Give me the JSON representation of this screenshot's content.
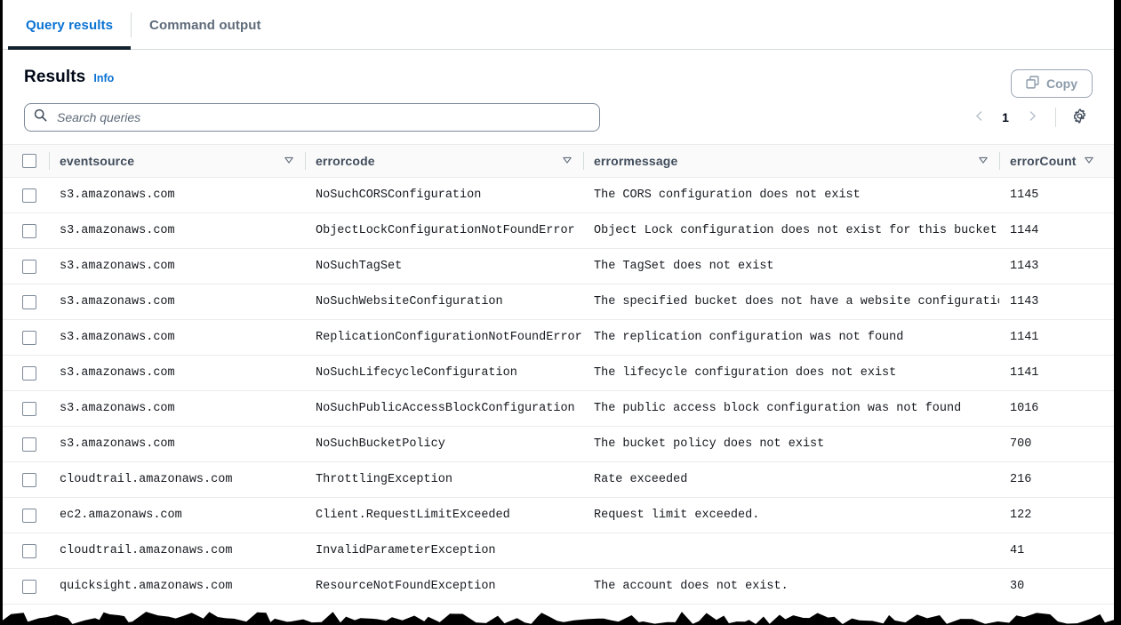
{
  "tabs": [
    {
      "label": "Query results",
      "active": true
    },
    {
      "label": "Command output",
      "active": false
    }
  ],
  "panel": {
    "title": "Results",
    "info_label": "Info"
  },
  "toolbar": {
    "copy_label": "Copy",
    "copy_icon": "copy-icon",
    "search_placeholder": "Search queries",
    "search_value": "",
    "search_icon": "search-icon",
    "prev_icon": "chevron-left-icon",
    "next_icon": "chevron-right-icon",
    "page_number": "1",
    "settings_icon": "gear-icon"
  },
  "table": {
    "columns": [
      {
        "key": "eventsource",
        "label": "eventsource",
        "sort_icon": "sort-descending-icon"
      },
      {
        "key": "errorcode",
        "label": "errorcode",
        "sort_icon": "sort-descending-icon"
      },
      {
        "key": "errormessage",
        "label": "errormessage",
        "sort_icon": "sort-descending-icon"
      },
      {
        "key": "errorCount",
        "label": "errorCount",
        "sort_icon": "sort-descending-icon"
      }
    ],
    "rows": [
      {
        "eventsource": "s3.amazonaws.com",
        "errorcode": "NoSuchCORSConfiguration",
        "errormessage": "The CORS configuration does not exist",
        "errorCount": "1145"
      },
      {
        "eventsource": "s3.amazonaws.com",
        "errorcode": "ObjectLockConfigurationNotFoundError",
        "errormessage": "Object Lock configuration does not exist for this bucket",
        "errorCount": "1144"
      },
      {
        "eventsource": "s3.amazonaws.com",
        "errorcode": "NoSuchTagSet",
        "errormessage": "The TagSet does not exist",
        "errorCount": "1143"
      },
      {
        "eventsource": "s3.amazonaws.com",
        "errorcode": "NoSuchWebsiteConfiguration",
        "errormessage": "The specified bucket does not have a website configuration",
        "errorCount": "1143"
      },
      {
        "eventsource": "s3.amazonaws.com",
        "errorcode": "ReplicationConfigurationNotFoundError",
        "errormessage": "The replication configuration was not found",
        "errorCount": "1141"
      },
      {
        "eventsource": "s3.amazonaws.com",
        "errorcode": "NoSuchLifecycleConfiguration",
        "errormessage": "The lifecycle configuration does not exist",
        "errorCount": "1141"
      },
      {
        "eventsource": "s3.amazonaws.com",
        "errorcode": "NoSuchPublicAccessBlockConfiguration",
        "errormessage": "The public access block configuration was not found",
        "errorCount": "1016"
      },
      {
        "eventsource": "s3.amazonaws.com",
        "errorcode": "NoSuchBucketPolicy",
        "errormessage": "The bucket policy does not exist",
        "errorCount": "700"
      },
      {
        "eventsource": "cloudtrail.amazonaws.com",
        "errorcode": "ThrottlingException",
        "errormessage": "Rate exceeded",
        "errorCount": "216"
      },
      {
        "eventsource": "ec2.amazonaws.com",
        "errorcode": "Client.RequestLimitExceeded",
        "errormessage": "Request limit exceeded.",
        "errorCount": "122"
      },
      {
        "eventsource": "cloudtrail.amazonaws.com",
        "errorcode": "InvalidParameterException",
        "errormessage": "",
        "errorCount": "41"
      },
      {
        "eventsource": "quicksight.amazonaws.com",
        "errorcode": "ResourceNotFoundException",
        "errormessage": "The account does not exist.",
        "errorCount": "30"
      }
    ]
  },
  "colors": {
    "accent_blue": "#0972d3",
    "tab_active_underline": "#12212e",
    "text_primary": "#16191f",
    "text_secondary": "#5f6b7a",
    "border": "#d5dbdb",
    "row_border": "#e9ebed",
    "header_bg": "#fafafa",
    "disabled": "#8c9bab"
  }
}
